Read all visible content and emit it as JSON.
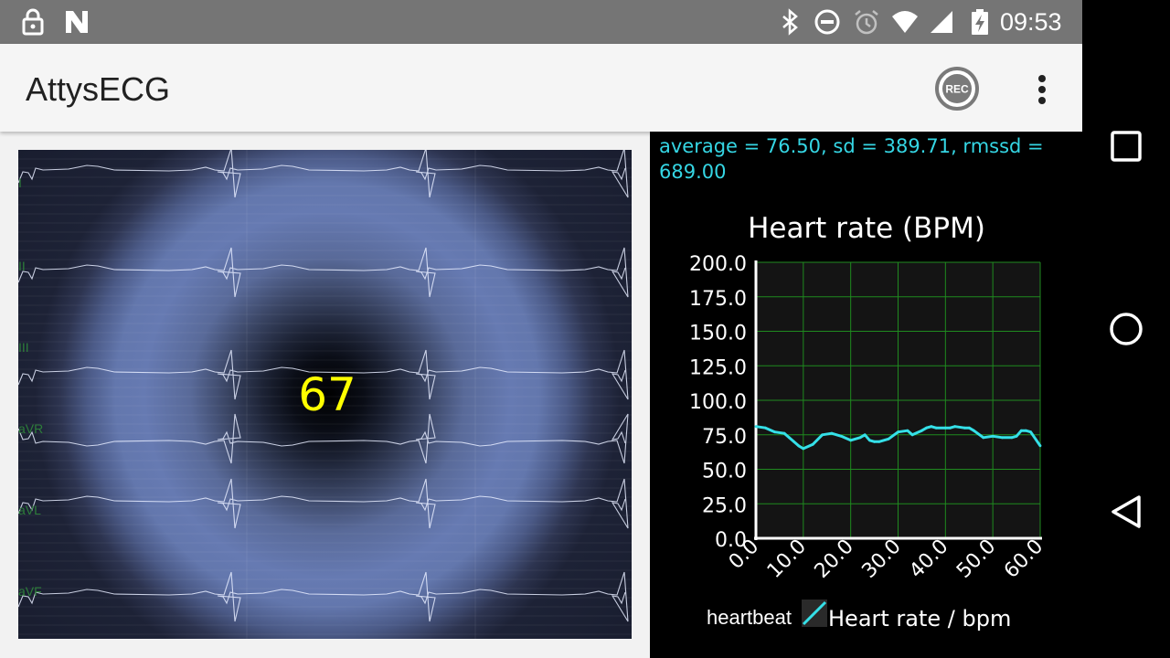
{
  "status_bar": {
    "time": "09:53",
    "left_icons": [
      "lock-icon",
      "notification-n-icon"
    ],
    "right_icons": [
      "bluetooth-icon",
      "do-not-disturb-icon",
      "alarm-icon",
      "wifi-icon",
      "signal-icon",
      "battery-charging-icon"
    ]
  },
  "app_bar": {
    "title": "AttysECG",
    "rec_label": "REC"
  },
  "nav_bar": {
    "buttons": [
      "recents-square-icon",
      "home-circle-icon",
      "back-triangle-icon"
    ]
  },
  "ecg": {
    "leads": [
      "I",
      "II",
      "III",
      "aVR",
      "aVL",
      "aVF"
    ],
    "bpm": "67",
    "colors": {
      "bpm_text": "#ffff00",
      "lead_label": "#2d7d3a",
      "trace": "#e6ecff"
    }
  },
  "heart_rate": {
    "stats_text": "average = 76.50, sd = 389.71, rmssd = 689.00",
    "colors": {
      "line": "#35e0e8",
      "grid": "#1f8a1f",
      "plot_bg": "#141414",
      "stats": "#35d6e4"
    }
  },
  "chart_data": {
    "type": "line",
    "title": "Heart rate (BPM)",
    "xlabel": "",
    "ylabel": "",
    "xlim": [
      0,
      60
    ],
    "ylim": [
      0,
      200
    ],
    "x_ticks": [
      "0.0",
      "10.0",
      "20.0",
      "30.0",
      "40.0",
      "50.0",
      "60.0"
    ],
    "y_ticks": [
      "0.0",
      "25.0",
      "50.0",
      "75.0",
      "100.0",
      "125.0",
      "150.0",
      "175.0",
      "200.0"
    ],
    "grid": true,
    "legend": {
      "placement": "bottom",
      "entries": [
        "heartbeat",
        "Heart rate / bpm"
      ]
    },
    "series": [
      {
        "name": "Heart rate / bpm",
        "x": [
          0,
          2,
          4,
          6,
          7,
          8,
          9,
          10,
          12,
          14,
          16,
          18,
          20,
          22,
          23,
          24,
          25,
          26,
          28,
          30,
          32,
          33,
          35,
          36,
          37,
          38,
          40,
          41,
          42,
          44,
          45,
          46,
          48,
          50,
          52,
          54,
          55,
          56,
          57,
          58,
          60
        ],
        "y": [
          81,
          80,
          77,
          76,
          73,
          70,
          67,
          65,
          68,
          75,
          76,
          74,
          71,
          73,
          75,
          71,
          70,
          70,
          72,
          77,
          78,
          75,
          78,
          80,
          81,
          80,
          80,
          80,
          81,
          80,
          80,
          78,
          73,
          74,
          73,
          73,
          74,
          78,
          78,
          77,
          67
        ]
      }
    ]
  }
}
